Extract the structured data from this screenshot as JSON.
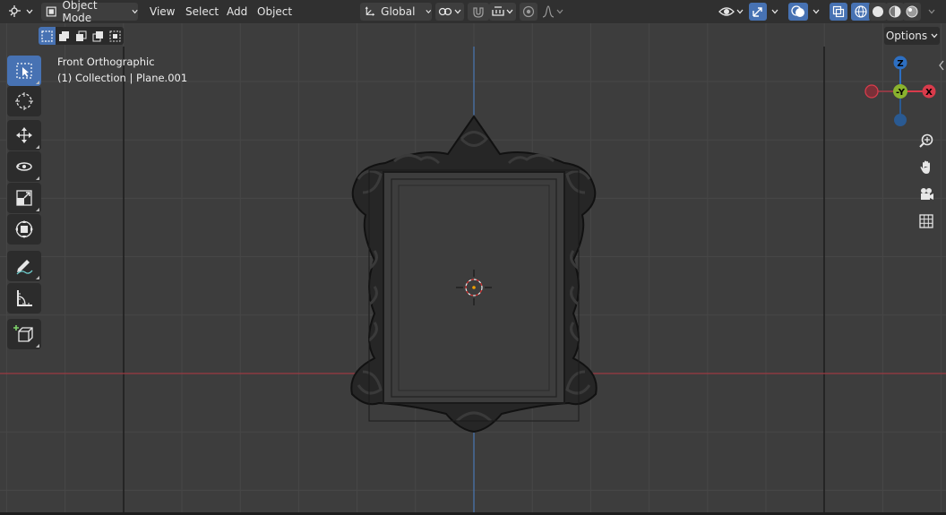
{
  "header": {
    "editor_type_icon": "viewport-camera-icon",
    "mode_label": "Object Mode",
    "menus": [
      "View",
      "Select",
      "Add",
      "Object"
    ],
    "transform_orientation": "Global",
    "icons": {
      "pivot": "pivot-point-icon",
      "snap": "snap-magnet-icon",
      "snap_target": "snap-increment-icon",
      "proportional": "proportional-edit-icon",
      "falloff": "falloff-curve-icon",
      "visibility": "eye-visibility-icon",
      "gizmo": "gizmo-toggle-icon",
      "overlays": "overlays-icon",
      "xray": "xray-icon",
      "shading_wireframe": "wireframe-shading-icon",
      "shading_solid": "solid-shading-icon",
      "shading_material": "material-shading-icon",
      "shading_rendered": "rendered-shading-icon"
    }
  },
  "toolbar_row2": {
    "options_label": "Options",
    "select_modes": [
      "select-new-icon",
      "select-extend-icon",
      "select-subtract-icon",
      "select-invert-icon",
      "select-intersect-icon"
    ]
  },
  "viewport": {
    "view_name": "Front Orthographic",
    "collection_info": "(1) Collection | Plane.001"
  },
  "tools": [
    {
      "name": "select-box-tool",
      "icon": "select-box-icon",
      "active": true
    },
    {
      "name": "cursor-tool",
      "icon": "cursor-3d-icon",
      "active": false
    },
    {
      "name": "move-tool",
      "icon": "move-arrows-icon",
      "active": false
    },
    {
      "name": "rotate-tool",
      "icon": "rotate-icon",
      "active": false
    },
    {
      "name": "scale-tool",
      "icon": "scale-icon",
      "active": false
    },
    {
      "name": "transform-tool",
      "icon": "transform-icon",
      "active": false
    },
    {
      "name": "annotate-tool",
      "icon": "annotate-pencil-icon",
      "active": false
    },
    {
      "name": "measure-tool",
      "icon": "measure-ruler-icon",
      "active": false
    },
    {
      "name": "add-cube-tool",
      "icon": "add-cube-icon",
      "active": false
    }
  ],
  "gizmo": {
    "z_label": "Z",
    "neg_y_label": "-Y",
    "x_label": "X",
    "colors": {
      "x": "#d93b4b",
      "y": "#8ab32e",
      "z": "#2d6fc2"
    }
  },
  "nav_buttons": [
    "zoom-icon",
    "pan-hand-icon",
    "camera-view-icon",
    "ortho-grid-icon"
  ],
  "colors": {
    "accent": "#4772b3",
    "x_axis_line": "#9c3a42",
    "z_axis_line": "#4a78b5",
    "background": "#3d3d3d"
  }
}
